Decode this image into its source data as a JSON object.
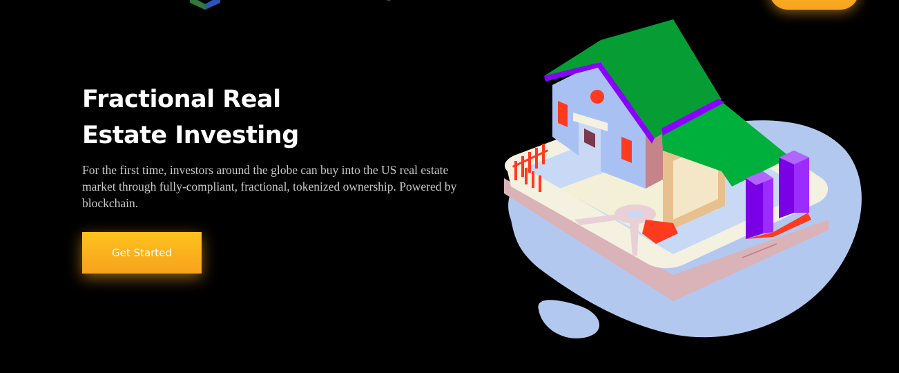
{
  "header": {
    "logo_icon": "cube-logo-icon",
    "top_cta_label": ""
  },
  "hero": {
    "title_line1": "Fractional Real",
    "title_line2": "Estate Investing",
    "description": "For the first time, investors around the globe can buy into the US real estate market through fully-compliant, fractional, tokenized ownership. Powered by blockchain.",
    "cta_label": "Get Started"
  },
  "illustration": {
    "icon": "house-on-phone-illustration",
    "colors": {
      "blob": "#b3c8ee",
      "roof": "#069d35",
      "roof_trim": "#8a00ff",
      "walls": "#a9c1f2",
      "accent_red": "#ff3b1f",
      "purple_blocks": "#8a00ff"
    }
  },
  "colors": {
    "background": "#000000",
    "accent": "#f7a51d",
    "text_primary": "#ffffff",
    "text_secondary": "#c8c8c8"
  }
}
